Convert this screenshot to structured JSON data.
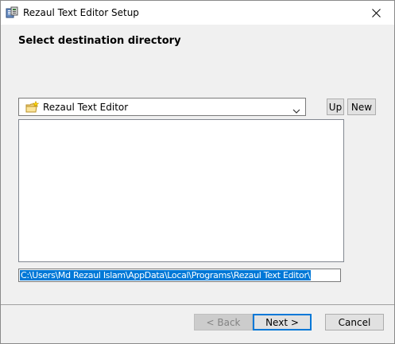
{
  "window": {
    "title": "Rezaul Text Editor Setup",
    "close_label": "×"
  },
  "page": {
    "heading": "Select destination directory"
  },
  "folder_combo": {
    "selected": "Rezaul Text Editor",
    "icon": "folder-star-icon"
  },
  "toolbar": {
    "up_label": "Up",
    "new_label": "New"
  },
  "path_field": {
    "value": "C:\\Users\\Md Rezaul Islam\\AppData\\Local\\Programs\\Rezaul Text Editor\\"
  },
  "footer": {
    "back_label": "< Back",
    "next_label": "Next >",
    "cancel_label": "Cancel"
  },
  "colors": {
    "selection": "#0078d7",
    "default_button_border": "#0078d7",
    "window_bg": "#f0f0f0"
  }
}
